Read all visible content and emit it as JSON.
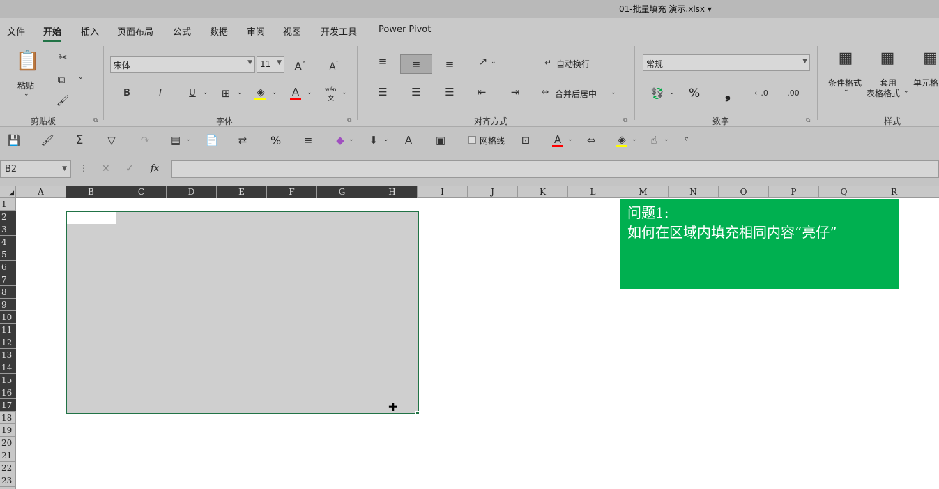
{
  "window": {
    "title": "01-批量填充 演示.xlsx  ▾"
  },
  "menu": {
    "tabs": [
      "文件",
      "开始",
      "插入",
      "页面布局",
      "公式",
      "数据",
      "审阅",
      "视图",
      "开发工具",
      "Power Pivot"
    ],
    "active": "开始"
  },
  "ribbon": {
    "clipboard": {
      "paste_label": "粘贴",
      "group_label": "剪贴板"
    },
    "font": {
      "font_name": "宋体",
      "font_size": "11",
      "group_label": "字体",
      "phonetic": "wén"
    },
    "alignment": {
      "wrap_text": "自动换行",
      "merge_center": "合并后居中",
      "group_label": "对齐方式"
    },
    "number": {
      "format": "常规",
      "percent": "%",
      "comma": "❟",
      "group_label": "数字"
    },
    "styles": {
      "conditional_1": "条件格式",
      "table_1": "套用",
      "table_2": "表格格式",
      "cell_styles": "单元格",
      "group_label": "样式"
    }
  },
  "qat": {
    "gridlines_label": "网格线",
    "percent": "%"
  },
  "formula_bar": {
    "name_box": "B2",
    "fx": "fx",
    "cancel": "✕",
    "confirm": "✓",
    "more": "⋮"
  },
  "sheet": {
    "columns": [
      "A",
      "B",
      "C",
      "D",
      "E",
      "F",
      "G",
      "H",
      "I",
      "J",
      "K",
      "L",
      "M",
      "N",
      "O",
      "P",
      "Q",
      "R"
    ],
    "rows": [
      "1",
      "2",
      "3",
      "4",
      "5",
      "6",
      "7",
      "8",
      "9",
      "10",
      "11",
      "12",
      "13",
      "14",
      "15",
      "16",
      "17",
      "18",
      "19",
      "20",
      "21",
      "22",
      "23"
    ],
    "selected_range": "B2:H17"
  },
  "note": {
    "line1": "问题1:",
    "line2": "如何在区域内填充相同内容“亮仔”"
  },
  "colors": {
    "accent": "#217346",
    "note_bg": "#00b050",
    "font_color_bar": "#ff0000",
    "highlight_bar": "#ffff00"
  }
}
